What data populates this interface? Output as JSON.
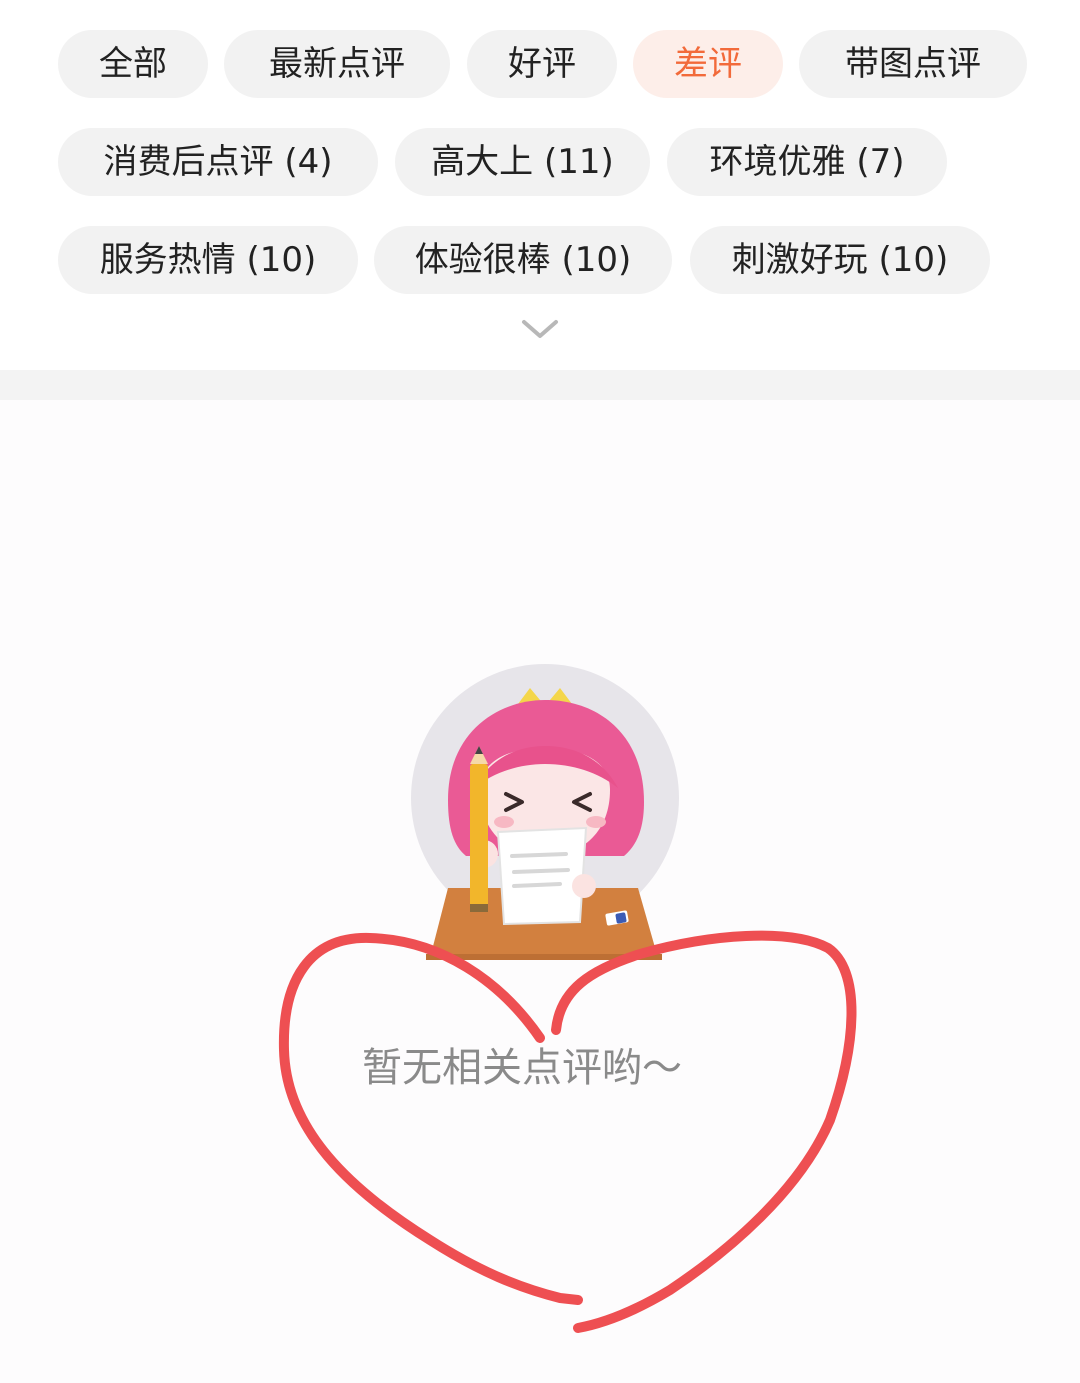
{
  "filters": {
    "tabs": [
      {
        "label": "全部",
        "active": false
      },
      {
        "label": "最新点评",
        "active": false
      },
      {
        "label": "好评",
        "active": false
      },
      {
        "label": "差评",
        "active": true
      },
      {
        "label": "带图点评",
        "active": false
      }
    ],
    "tags": [
      {
        "label": "消费后点评 (4)"
      },
      {
        "label": "高大上 (11)"
      },
      {
        "label": "环境优雅 (7)"
      },
      {
        "label": "服务热情 (10)"
      },
      {
        "label": "体验很棒 (10)"
      },
      {
        "label": "刺激好玩 (10)"
      }
    ],
    "expand_icon": "chevron-down-icon"
  },
  "empty_state": {
    "message": "暂无相关点评哟～",
    "illustration_icon": "girl-writing-review-illustration"
  },
  "annotation": {
    "shape": "heart",
    "color": "#ee4f52"
  },
  "colors": {
    "accent": "#f26a3a",
    "accent_bg": "#fdeee9",
    "chip_bg": "#f2f2f2"
  }
}
